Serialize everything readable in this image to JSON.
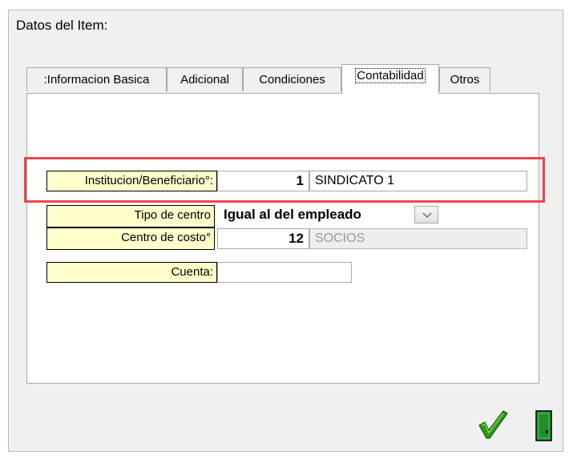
{
  "window": {
    "title": "Datos del Item:"
  },
  "tabs": [
    {
      "label": ":Informacion Basica"
    },
    {
      "label": "Adicional"
    },
    {
      "label": "Condiciones"
    },
    {
      "label": "Contabilidad",
      "active": true
    },
    {
      "label": "Otros"
    }
  ],
  "form": {
    "institucion": {
      "label": "Institucion/Beneficiario°:",
      "code": "1",
      "name": "SINDICATO 1"
    },
    "tipo_centro": {
      "label": "Tipo de centro",
      "value": "Igual al del empleado"
    },
    "centro_costo": {
      "label": "Centro de costo°",
      "code": "12",
      "name": "SOCIOS"
    },
    "cuenta": {
      "label": "Cuenta:",
      "value": ""
    }
  },
  "icons": {
    "ok": "checkmark-icon",
    "exit": "door-icon"
  },
  "colors": {
    "label_bg": "#ffffcc",
    "highlight": "#e8474f",
    "check": "#2e9b1c",
    "door": "#1f8f2c"
  }
}
